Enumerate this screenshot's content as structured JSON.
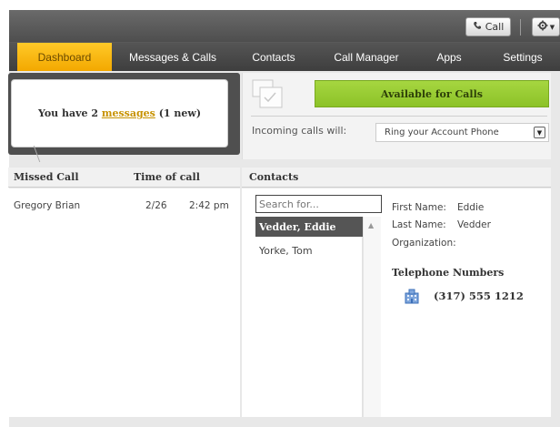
{
  "toolbar": {
    "call_label": "Call",
    "call_icon": "phone-icon",
    "settings_icon": "gear-icon"
  },
  "nav": {
    "tabs": [
      {
        "label": "Dashboard",
        "active": true
      },
      {
        "label": "Messages & Calls",
        "active": false
      },
      {
        "label": "Contacts",
        "active": false
      },
      {
        "label": "Call Manager",
        "active": false
      },
      {
        "label": "Apps",
        "active": false
      },
      {
        "label": "Settings",
        "active": false
      }
    ]
  },
  "messages": {
    "prefix": "You have 2 ",
    "link": "messages",
    "suffix": " (1 new)"
  },
  "availability": {
    "button_label": "Available for Calls",
    "incoming_label": "Incoming calls will:",
    "ring_option": "Ring your Account Phone"
  },
  "missed_calls": {
    "header_name": "Missed Call",
    "header_time": "Time of call",
    "rows": [
      {
        "name": "Gregory Brian",
        "date": "2/26",
        "time": "2:42 pm"
      }
    ]
  },
  "contacts": {
    "header": "Contacts",
    "search_placeholder": "Search for...",
    "list": [
      {
        "name": "Vedder, Eddie",
        "selected": true
      },
      {
        "name": "Yorke, Tom",
        "selected": false
      }
    ],
    "detail": {
      "first_name_label": "First Name:",
      "first_name": "Eddie",
      "last_name_label": "Last Name:",
      "last_name": "Vedder",
      "organization_label": "Organization:",
      "organization": "",
      "telephone_heading": "Telephone Numbers",
      "phone": "(317) 555 1212",
      "phone_icon": "building-icon"
    }
  },
  "colors": {
    "active_tab": "#f7b200",
    "available_green": "#95c832",
    "link_gold": "#c79200",
    "selected_contact": "#555555"
  }
}
